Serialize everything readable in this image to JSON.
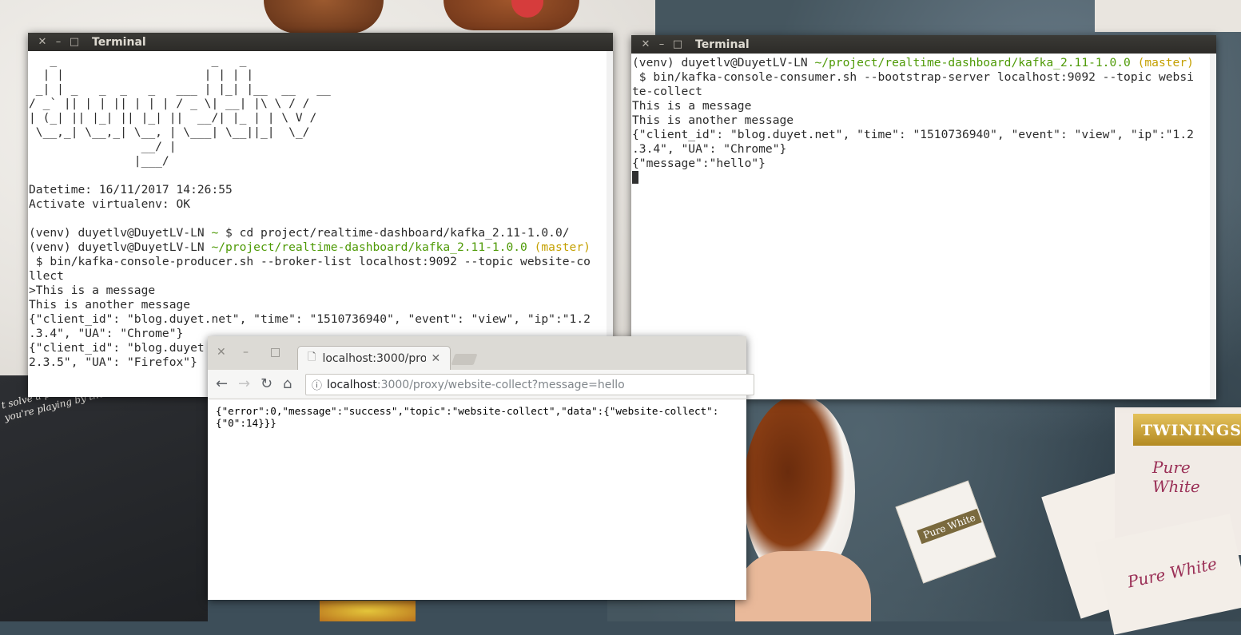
{
  "wallpaper": {
    "book_quote_line1": "t solve a problem, it c",
    "book_quote_line2": "you're playing by the rules.",
    "tea_brand": "TWININGS",
    "tea_name": "Pure White",
    "tea_name_2": "Pure White",
    "teabag_label": "Pure White"
  },
  "terminal_left": {
    "title": "Terminal",
    "ascii_art": [
      "   _                      _   _",
      "  | |                    | | | |",
      " _| | _   _  _   _   ___ | |_| |__  __   __",
      "/ _` || | | || | | | / _ \\| __| |\\ \\ / /",
      "| (_| || |_| || |_| ||  __/| |_ | | \\ V /",
      " \\__,_| \\__,_| \\__, | \\___| \\__||_|  \\_/",
      "                __/ |",
      "               |___/"
    ],
    "datetime_line": "Datetime: 16/11/2017 14:26:55",
    "venv_line": "Activate virtualenv: OK",
    "cmd1_prompt": "(venv) duyetlv@DuyetLV-LN",
    "cmd1_path": " ~ ",
    "cmd1_text": "$ cd project/realtime-dashboard/kafka_2.11-1.0.0/",
    "cmd2_prompt": "(venv) duyetlv@DuyetLV-LN",
    "cmd2_path": " ~/project/realtime-dashboard/kafka_2.11-1.0.0",
    "cmd2_branch": " (master)",
    "cmd2_line1": " $ bin/kafka-console-producer.sh --broker-list localhost:9092 --topic website-co",
    "cmd2_line2": "llect",
    "out1": ">This is a message",
    "out2": "This is another message",
    "out3": "{\"client_id\": \"blog.duyet.net\", \"time\": \"1510736940\", \"event\": \"view\", \"ip\":\"1.2",
    "out4": ".3.4\", \"UA\": \"Chrome\"}",
    "out5": "{\"client_id\": \"blog.duyet",
    "out6": "2.3.5\", \"UA\": \"Firefox\"}"
  },
  "terminal_right": {
    "title": "Terminal",
    "prompt": "(venv) duyetlv@DuyetLV-LN",
    "path": " ~/project/realtime-dashboard/kafka_2.11-1.0.0",
    "branch": " (master)",
    "cmd_line1": " $ bin/kafka-console-consumer.sh --bootstrap-server localhost:9092 --topic websi",
    "cmd_line2": "te-collect",
    "out1": "This is a message",
    "out2": "This is another message",
    "out3": "{\"client_id\": \"blog.duyet.net\", \"time\": \"1510736940\", \"event\": \"view\", \"ip\":\"1.2",
    "out4": ".3.4\", \"UA\": \"Chrome\"}",
    "out5": "{\"message\":\"hello\"}"
  },
  "browser": {
    "tab_title": "localhost:3000/pro",
    "url_host": "localhost",
    "url_rest": ":3000/proxy/website-collect?message=hello",
    "body_line1": "{\"error\":0,\"message\":\"success\",\"topic\":\"website-collect\",\"data\":{\"website-collect\":",
    "body_line2": "{\"0\":14}}}"
  },
  "colors": {
    "prompt_path": "#4e9a06",
    "prompt_branch": "#c4a000",
    "titlebar": "#2c2b28"
  }
}
